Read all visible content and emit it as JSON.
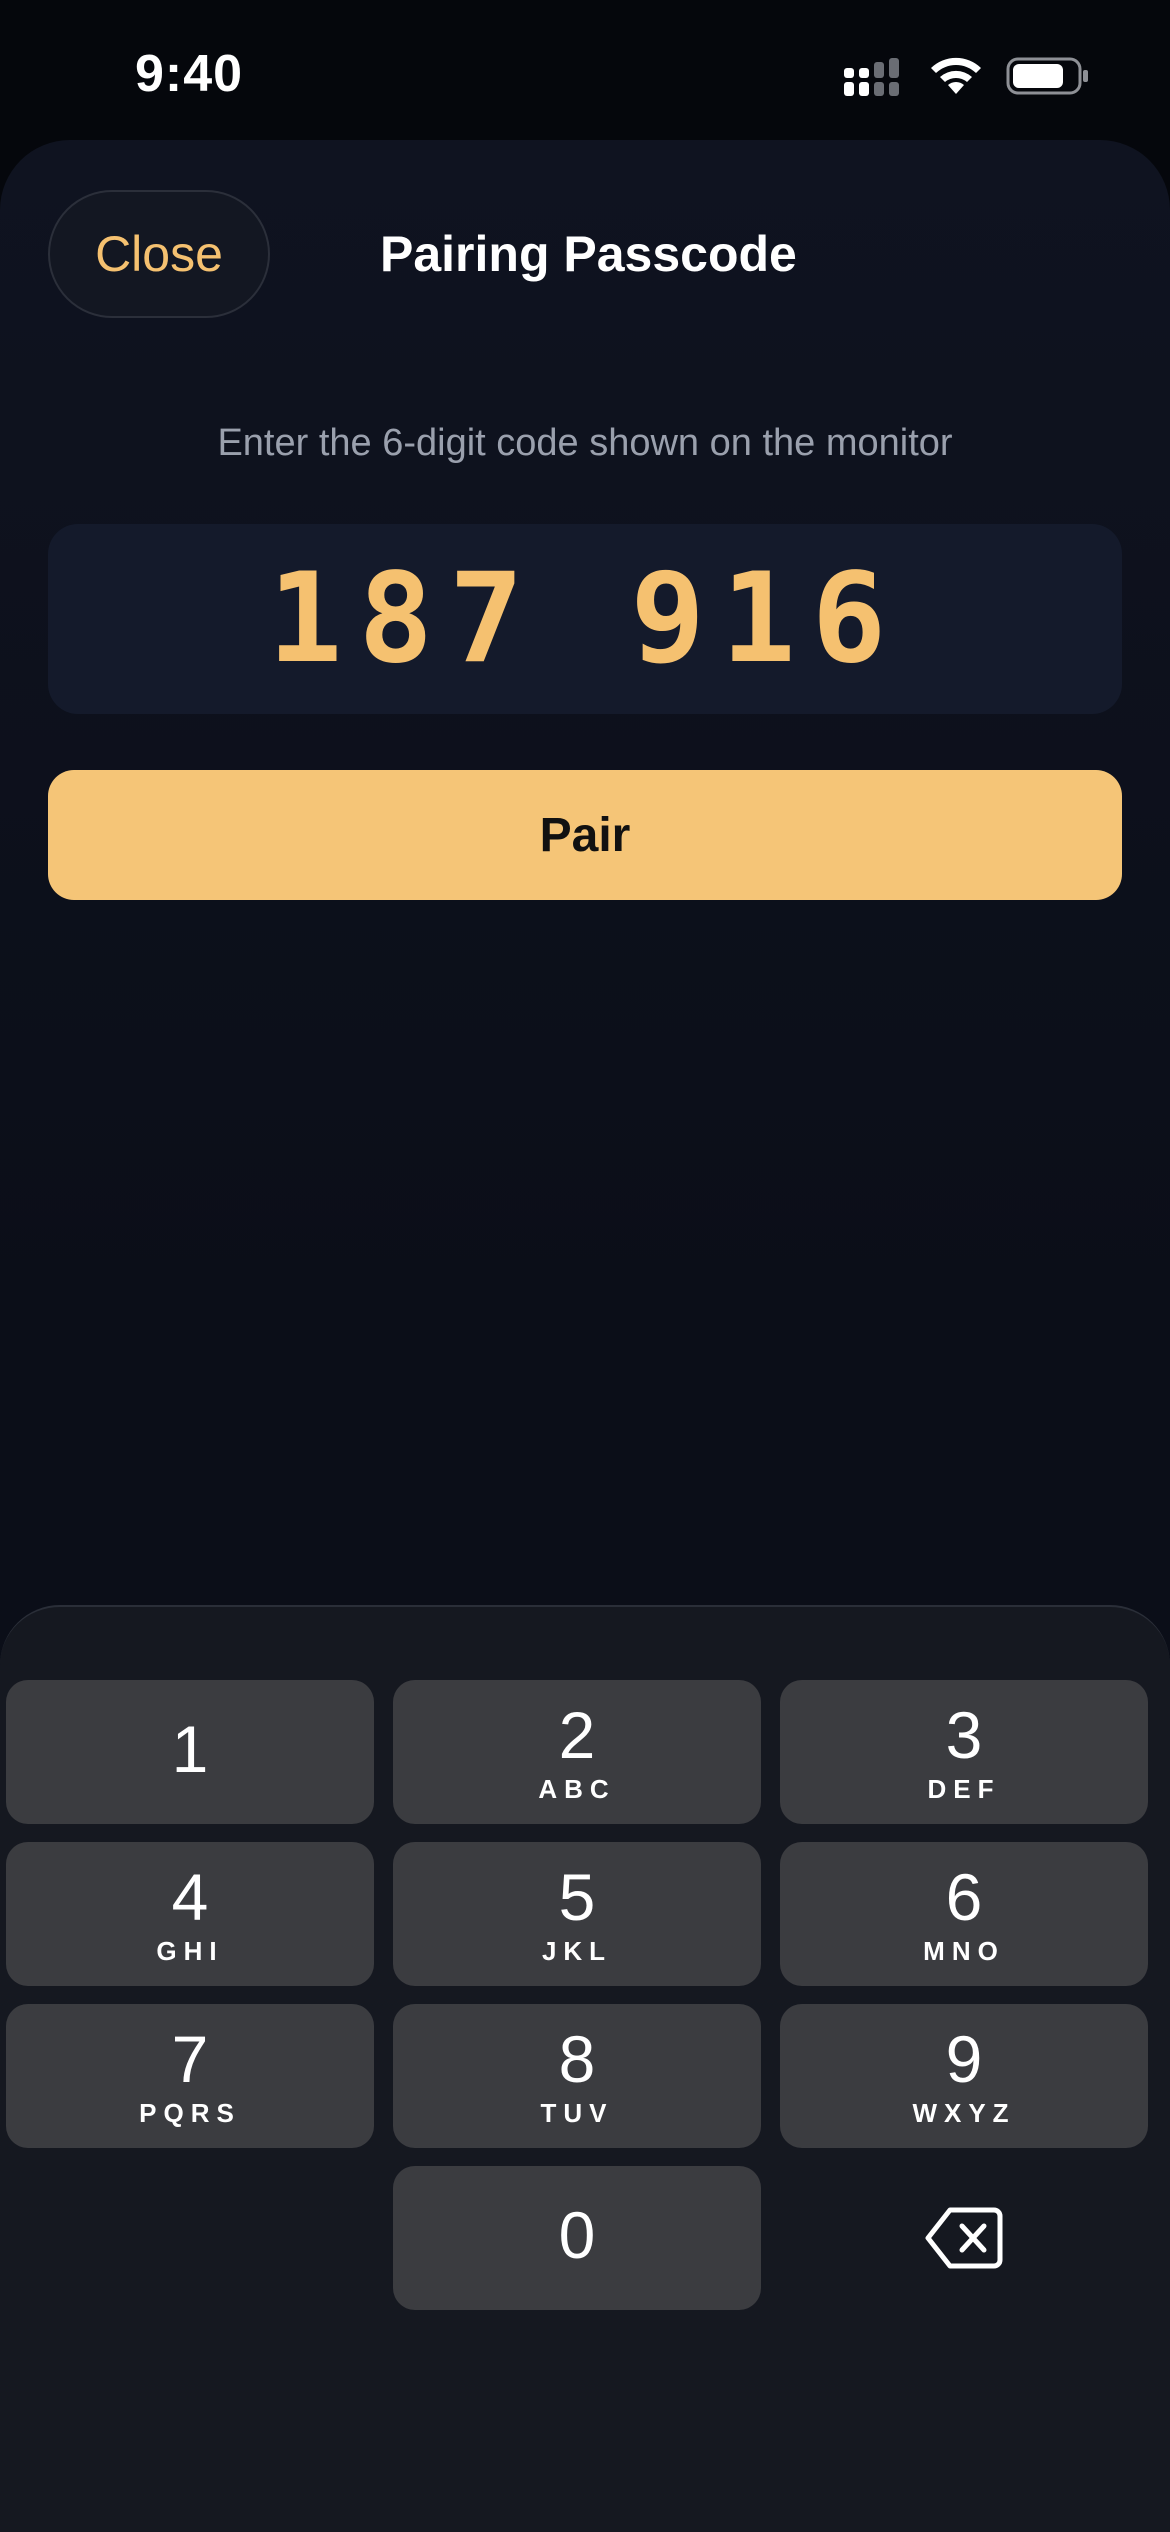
{
  "status_bar": {
    "time": "9:40"
  },
  "sheet": {
    "close_label": "Close",
    "title": "Pairing Passcode",
    "instruction": "Enter the 6-digit code shown on the monitor",
    "code": "187 916",
    "pair_label": "Pair"
  },
  "keypad": {
    "keys": [
      {
        "digit": "1",
        "letters": ""
      },
      {
        "digit": "2",
        "letters": "ABC"
      },
      {
        "digit": "3",
        "letters": "DEF"
      },
      {
        "digit": "4",
        "letters": "GHI"
      },
      {
        "digit": "5",
        "letters": "JKL"
      },
      {
        "digit": "6",
        "letters": "MNO"
      },
      {
        "digit": "7",
        "letters": "PQRS"
      },
      {
        "digit": "8",
        "letters": "TUV"
      },
      {
        "digit": "9",
        "letters": "WXYZ"
      },
      {
        "digit": "0",
        "letters": ""
      }
    ],
    "backspace_icon": "delete-left-icon"
  },
  "colors": {
    "accent": "#f5c170",
    "pair_button": "#f5c577",
    "key_background": "#3b3c40",
    "sheet_background": "#0f1320"
  }
}
